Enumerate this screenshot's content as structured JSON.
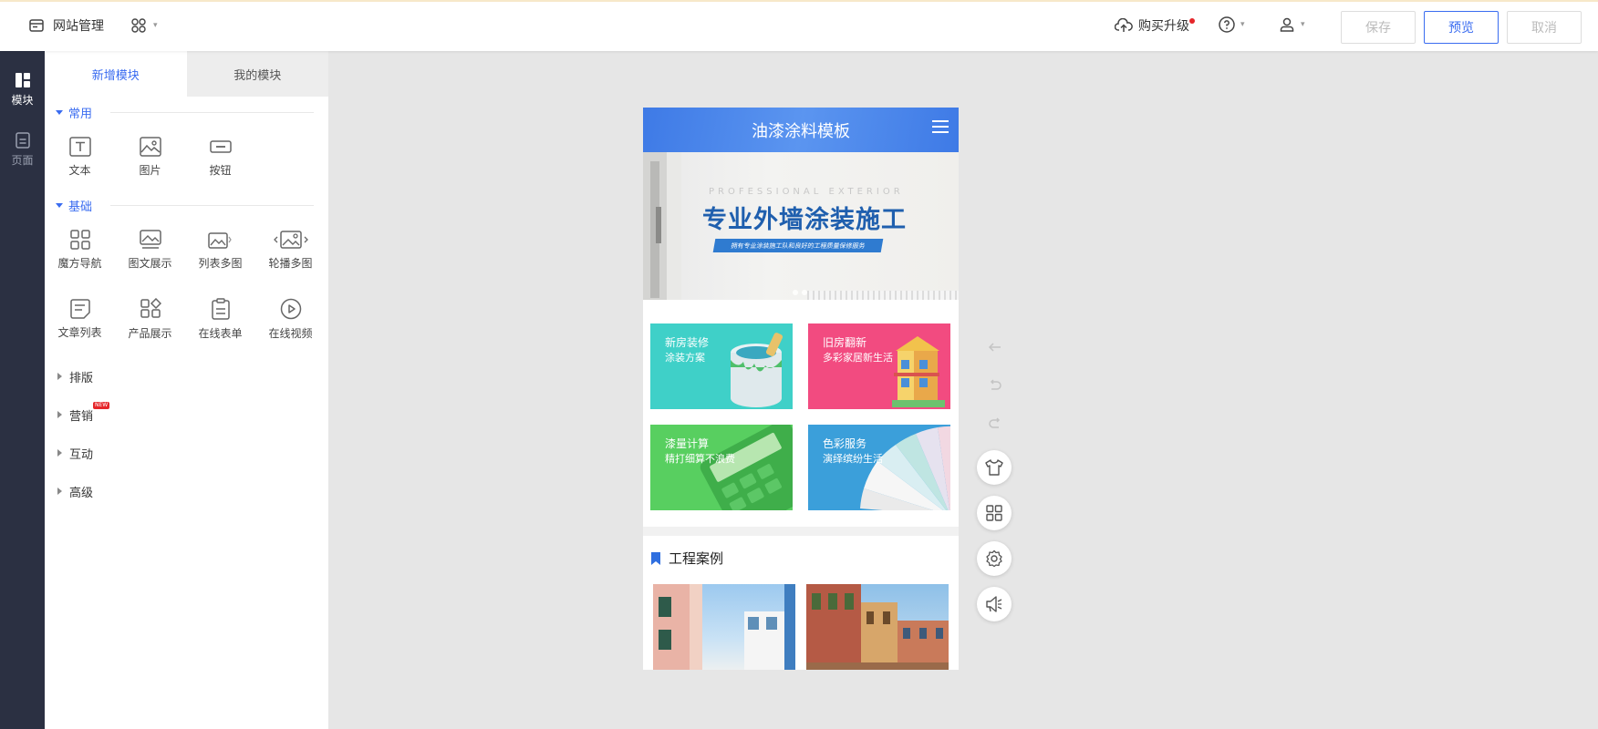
{
  "topbar": {
    "site_manage": "网站管理",
    "upgrade": "购买升级",
    "save": "保存",
    "preview": "预览",
    "cancel": "取消"
  },
  "leftnav": {
    "items": [
      {
        "label": "模块",
        "active": true
      },
      {
        "label": "页面",
        "active": false
      }
    ]
  },
  "panel": {
    "tabs": [
      "新增模块",
      "我的模块"
    ],
    "common": {
      "title": "常用",
      "items": [
        "文本",
        "图片",
        "按钮"
      ]
    },
    "basic": {
      "title": "基础",
      "items": [
        "魔方导航",
        "图文展示",
        "列表多图",
        "轮播多图",
        "文章列表",
        "产品展示",
        "在线表单",
        "在线视频"
      ]
    },
    "groups": [
      "排版",
      "营销",
      "互动",
      "高级"
    ],
    "new_badge": "NEW"
  },
  "phone": {
    "title": "油漆涂料模板",
    "banner": {
      "eng": "PROFESSIONAL EXTERIOR",
      "title": "专业外墙涂装施工",
      "subtitle": "拥有专业涂装施工队和良好的工程质量保修服务"
    },
    "tiles": [
      {
        "title": "新房装修",
        "sub": "涂装方案",
        "color": "#3fd0c8"
      },
      {
        "title": "旧房翻新",
        "sub": "多彩家居新生活",
        "color": "#f24b80"
      },
      {
        "title": "漆量计算",
        "sub": "精打细算不浪费",
        "color": "#58cf60"
      },
      {
        "title": "色彩服务",
        "sub": "演绎缤纷生活",
        "color": "#3b9fda"
      }
    ],
    "section_title": "工程案例"
  },
  "colors": {
    "accent": "#3a6cf0",
    "nav_bg": "#2b3042"
  }
}
